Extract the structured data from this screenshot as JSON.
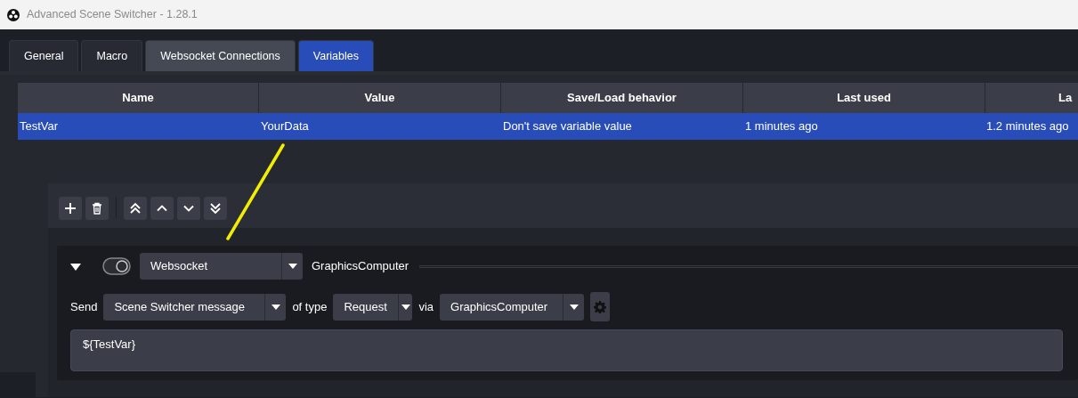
{
  "window": {
    "title": "Advanced Scene Switcher - 1.28.1"
  },
  "tabs": [
    {
      "label": "General",
      "selected": false,
      "hovered": false
    },
    {
      "label": "Macro",
      "selected": false,
      "hovered": false
    },
    {
      "label": "Websocket Connections",
      "selected": false,
      "hovered": true
    },
    {
      "label": "Variables",
      "selected": true,
      "hovered": false
    }
  ],
  "table": {
    "columns": [
      "Name",
      "Value",
      "Save/Load behavior",
      "Last used",
      "La"
    ],
    "rows": [
      {
        "cells": [
          "TestVar",
          "YourData",
          "Don't save variable value",
          "1 minutes ago",
          "1.2 minutes ago"
        ],
        "selected": true
      }
    ]
  },
  "action": {
    "expanded": true,
    "on": true,
    "type": "Websocket",
    "title": "GraphicsComputer",
    "send_label": "Send",
    "message_kind": "Scene Switcher message",
    "of_type_label": "of type",
    "request_type": "Request",
    "via_label": "via",
    "connection": "GraphicsComputer",
    "message": "${TestVar}"
  }
}
